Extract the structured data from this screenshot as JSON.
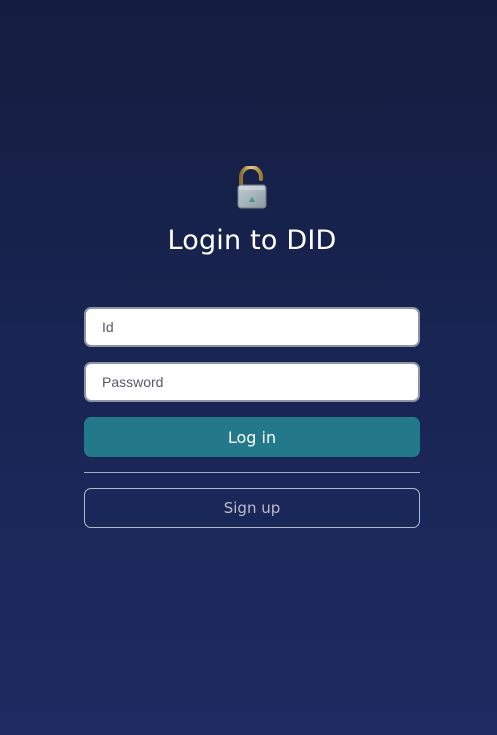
{
  "login": {
    "lock_icon": "open-padlock-icon",
    "title": "Login to DID",
    "id_placeholder": "Id",
    "id_value": "",
    "password_placeholder": "Password",
    "password_value": "",
    "login_label": "Log in",
    "signup_label": "Sign up"
  },
  "colors": {
    "background_top": "#141d3f",
    "background_bottom": "#1d2b62",
    "login_button": "#23788a",
    "signup_border": "#b3b8c9"
  }
}
